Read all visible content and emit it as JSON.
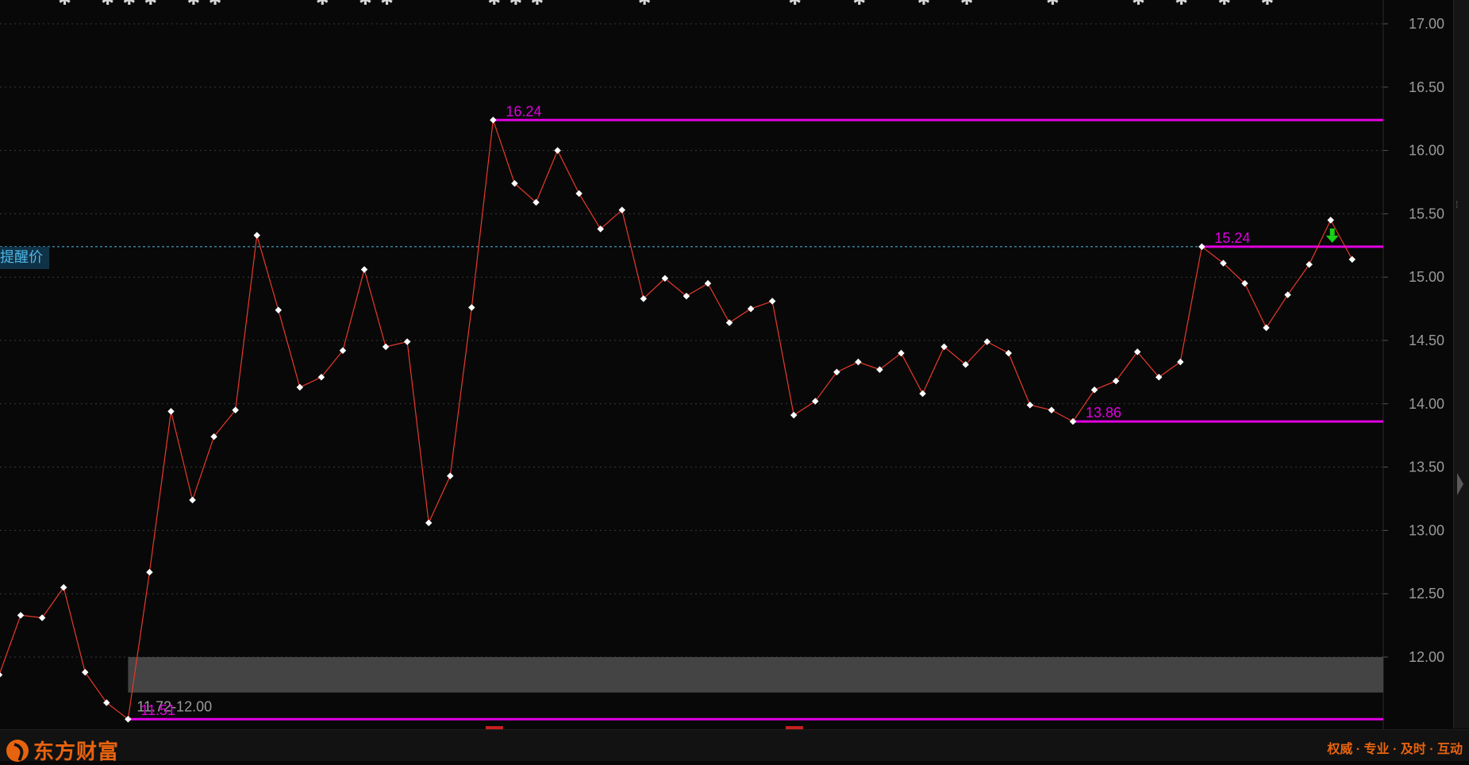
{
  "app": {
    "logo_text": "东方财富",
    "slogan": "权威 · 专业 · 及时 · 互动"
  },
  "alert_price": {
    "label": "提醒价",
    "value": 15.24,
    "color": "#4fb8e8"
  },
  "colors": {
    "background": "#080808",
    "price_line": "#e8392b",
    "point": "#ffffff",
    "level_line": "#e000e0",
    "zone": "#444444",
    "axis_text": "#9a9a9a",
    "down_arrow": "#19d219",
    "brand": "#e8630e"
  },
  "icons": {
    "top_markers": "asterisk-icon",
    "signal": "down-arrow-icon",
    "logo": "eastmoney-logo-icon"
  },
  "chart_data": {
    "type": "line",
    "ylim": [
      11.5,
      17.05
    ],
    "yticks": [
      "17.00",
      "16.50",
      "16.00",
      "15.50",
      "15.00",
      "14.50",
      "14.00",
      "13.50",
      "13.00",
      "12.50",
      "12.00"
    ],
    "grid": true,
    "series": [
      {
        "values": [
          11.86,
          12.33,
          12.31,
          12.55,
          11.88,
          11.64,
          11.51,
          12.67,
          13.94,
          13.24,
          13.74,
          13.95,
          15.33,
          14.74,
          14.13,
          14.21,
          14.42,
          15.06,
          14.45,
          14.49,
          13.06,
          13.43,
          14.76,
          16.24,
          15.74,
          15.59,
          16.0,
          15.66,
          15.38,
          15.53,
          14.83,
          14.99,
          14.85,
          14.95,
          14.64,
          14.75,
          14.81,
          13.91,
          14.02,
          14.25,
          14.33,
          14.27,
          14.4,
          14.08,
          14.45,
          14.31,
          14.49,
          14.4,
          13.99,
          13.95,
          13.86,
          14.11,
          14.18,
          14.41,
          14.21,
          14.33,
          15.24,
          15.11,
          14.95,
          14.6,
          14.86,
          15.1,
          15.45,
          15.14
        ]
      }
    ],
    "levels": [
      {
        "label": "16.24",
        "value": 16.24,
        "start_index": 23
      },
      {
        "label": "15.24",
        "value": 15.24,
        "start_index": 56
      },
      {
        "label": "13.86",
        "value": 13.86,
        "start_index": 50
      },
      {
        "label": "11.51",
        "value": 11.51,
        "start_index": 6
      }
    ],
    "zone": {
      "label": "11.72-12.00",
      "low": 11.72,
      "high": 12.0,
      "start_index": 6
    },
    "top_marker_indices": [
      3,
      5,
      6,
      7,
      9,
      10,
      15,
      17,
      18,
      23,
      24,
      25,
      30,
      37,
      40,
      43,
      45,
      49,
      53,
      55,
      57,
      59
    ],
    "signal_index": 63
  }
}
